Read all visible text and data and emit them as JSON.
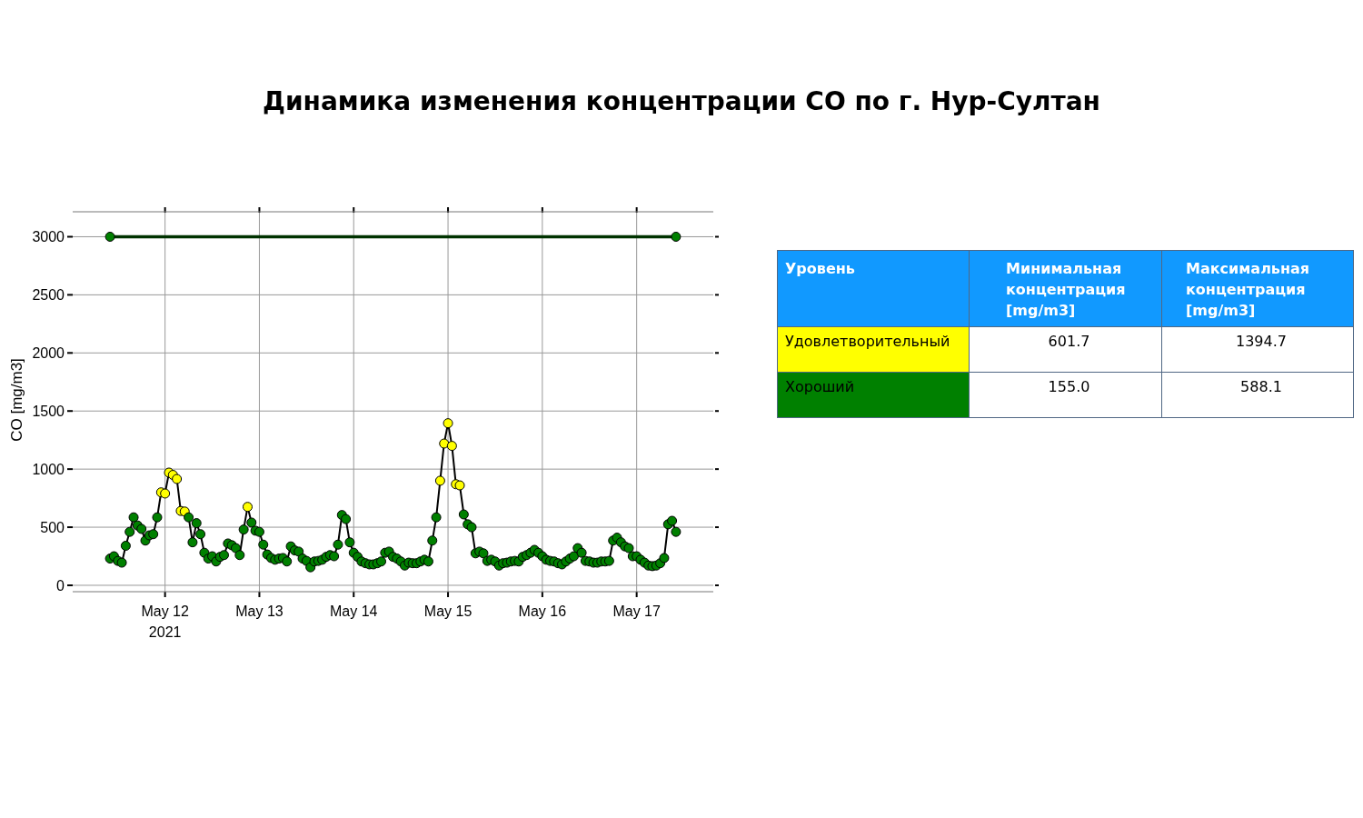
{
  "title": "Динамика изменения концентрации CO по г. Нур-Султан",
  "chart": {
    "chart_data": {
      "type": "line",
      "ylabel": "CO [mg/m3]",
      "categories": [
        null,
        null,
        null,
        null,
        null,
        null,
        null,
        null,
        null,
        null,
        null,
        null,
        null,
        null,
        "May 12\n2021",
        null,
        null,
        null,
        null,
        null,
        null,
        null,
        null,
        null,
        null,
        null,
        null,
        null,
        null,
        null,
        null,
        null,
        null,
        null,
        null,
        null,
        null,
        null,
        "May 13",
        null,
        null,
        null,
        null,
        null,
        null,
        null,
        null,
        null,
        null,
        null,
        null,
        null,
        null,
        null,
        null,
        null,
        null,
        null,
        null,
        null,
        null,
        null,
        "May 14",
        null,
        null,
        null,
        null,
        null,
        null,
        null,
        null,
        null,
        null,
        null,
        null,
        null,
        null,
        null,
        null,
        null,
        null,
        null,
        null,
        null,
        null,
        null,
        "May 15",
        null,
        null,
        null,
        null,
        null,
        null,
        null,
        null,
        null,
        null,
        null,
        null,
        null,
        null,
        null,
        null,
        null,
        null,
        null,
        null,
        null,
        null,
        null,
        "May 16",
        null,
        null,
        null,
        null,
        null,
        null,
        null,
        null,
        null,
        null,
        null,
        null,
        null,
        null,
        null,
        null,
        null,
        null,
        null,
        null,
        null,
        null,
        null,
        "May 17",
        null,
        null,
        null,
        null,
        null,
        null,
        null,
        null,
        null,
        null
      ],
      "series": [
        {
          "color": "#000000",
          "marker": true,
          "values": [
            230,
            250,
            210,
            195,
            340,
            460,
            585,
            515,
            485,
            385,
            430,
            440,
            585,
            800,
            790,
            970,
            950,
            915,
            640,
            635,
            585,
            370,
            535,
            440,
            280,
            230,
            250,
            205,
            245,
            260,
            360,
            345,
            320,
            260,
            480,
            675,
            540,
            470,
            460,
            350,
            265,
            235,
            220,
            230,
            235,
            205,
            335,
            300,
            290,
            230,
            210,
            155,
            205,
            210,
            220,
            245,
            260,
            250,
            350,
            605,
            570,
            370,
            280,
            245,
            205,
            190,
            180,
            180,
            190,
            205,
            280,
            290,
            245,
            230,
            205,
            170,
            195,
            190,
            190,
            205,
            220,
            205,
            385,
            585,
            900,
            1220,
            1395,
            1200,
            870,
            860,
            610,
            525,
            500,
            275,
            290,
            275,
            210,
            220,
            205,
            170,
            190,
            195,
            205,
            210,
            205,
            245,
            260,
            280,
            305,
            280,
            250,
            220,
            210,
            205,
            190,
            180,
            205,
            230,
            250,
            320,
            280,
            210,
            205,
            195,
            195,
            205,
            205,
            210,
            385,
            410,
            370,
            335,
            320,
            250,
            250,
            220,
            195,
            170,
            165,
            170,
            190,
            235,
            525,
            555,
            460
          ]
        },
        {
          "color": "#003300",
          "marker": true,
          "values": [
            3000,
            null,
            null,
            null,
            null,
            null,
            null,
            null,
            null,
            null,
            null,
            null,
            null,
            null,
            null,
            null,
            null,
            null,
            null,
            null,
            null,
            null,
            null,
            null,
            null,
            null,
            null,
            null,
            null,
            null,
            null,
            null,
            null,
            null,
            null,
            null,
            null,
            null,
            null,
            null,
            null,
            null,
            null,
            null,
            null,
            null,
            null,
            null,
            null,
            null,
            null,
            null,
            null,
            null,
            null,
            null,
            null,
            null,
            null,
            null,
            null,
            null,
            null,
            null,
            null,
            null,
            null,
            null,
            null,
            null,
            null,
            null,
            null,
            null,
            null,
            null,
            null,
            null,
            null,
            null,
            null,
            null,
            null,
            null,
            null,
            null,
            null,
            null,
            null,
            null,
            null,
            null,
            null,
            null,
            null,
            null,
            null,
            null,
            null,
            null,
            null,
            null,
            null,
            null,
            null,
            null,
            null,
            null,
            null,
            null,
            null,
            null,
            null,
            null,
            null,
            null,
            null,
            null,
            null,
            null,
            null,
            null,
            null,
            null,
            null,
            null,
            null,
            null,
            null,
            null,
            null,
            null,
            null,
            null,
            null,
            null,
            null,
            null,
            null,
            null,
            null,
            null,
            null,
            null,
            3000
          ]
        }
      ],
      "grid": true,
      "ylim": [
        -55,
        3215
      ],
      "yticks": [
        0,
        500,
        1000,
        1500,
        2000,
        2500,
        3000
      ]
    }
  },
  "table": {
    "columns": [
      "Уровень",
      "Минимальная концентрация [mg/m3]",
      "Максимальная концентрация [mg/m3]"
    ],
    "rows": [
      {
        "level": "Удовлетворительный",
        "color": "#ffff00",
        "min": "601.7",
        "max": "1394.7"
      },
      {
        "level": "Хороший",
        "color": "#008000",
        "min": "155.0",
        "max": "588.1"
      }
    ]
  }
}
